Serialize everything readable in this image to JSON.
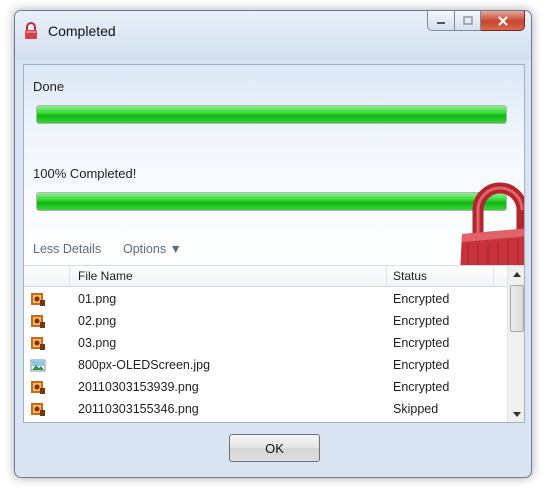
{
  "window": {
    "title": "Completed",
    "title_icon": "padlock-icon"
  },
  "progress_primary": {
    "label": "Done",
    "value": 1.0
  },
  "progress_total": {
    "label": "100% Completed!",
    "value": 1.0
  },
  "details": {
    "less_details_label": "Less Details",
    "options_label": "Options ▼"
  },
  "file_list": {
    "columns": [
      "File Name",
      "Status"
    ],
    "rows": [
      {
        "icon": "png-image-icon",
        "name": "01.png",
        "status": "Encrypted"
      },
      {
        "icon": "png-image-icon",
        "name": "02.png",
        "status": "Encrypted"
      },
      {
        "icon": "png-image-icon",
        "name": "03.png",
        "status": "Encrypted"
      },
      {
        "icon": "jpg-image-icon",
        "name": "800px-OLEDScreen.jpg",
        "status": "Encrypted"
      },
      {
        "icon": "png-image-icon",
        "name": "20110303153939.png",
        "status": "Encrypted"
      },
      {
        "icon": "png-image-icon",
        "name": "20110303155346.png",
        "status": "Skipped"
      }
    ]
  },
  "buttons": {
    "ok_label": "OK"
  },
  "colors": {
    "progress_green": "#22c722",
    "padlock_red": "#c8323a"
  }
}
